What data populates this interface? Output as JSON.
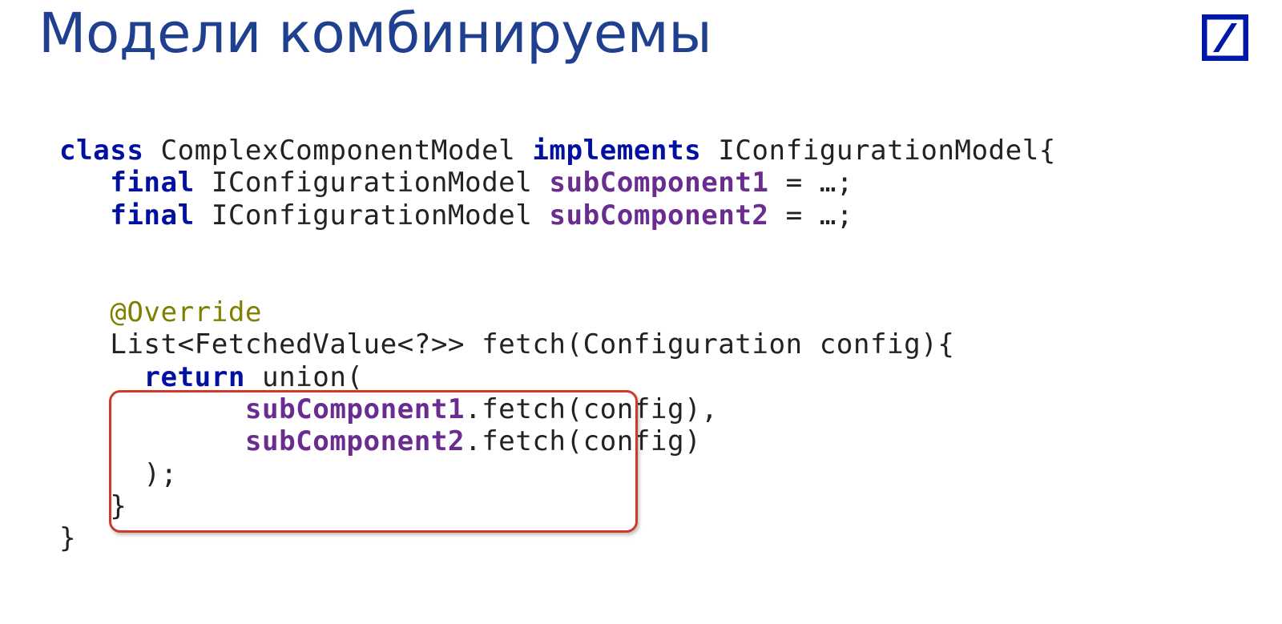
{
  "title": "Модели комбинируемы",
  "code": {
    "kw_class": "class",
    "classname": " ComplexComponentModel ",
    "kw_implements": "implements",
    "iface_tail": " IConfigurationModel{",
    "indent1": "   ",
    "kw_final1": "final",
    "type1": " IConfigurationModel ",
    "fld1": "subComponent1",
    "assign1": " = …;",
    "kw_final2": "final",
    "type2": " IConfigurationModel ",
    "fld2": "subComponent2",
    "assign2": " = …;",
    "ann": "@Override",
    "sig": "List<FetchedValue<?>> fetch(Configuration config){",
    "indent2": "     ",
    "kw_return": "return",
    "union_open": " union(",
    "indent_arg": "           ",
    "arg1_fld": "subComponent1",
    "arg1_tail": ".fetch(config),",
    "arg2_fld": "subComponent2",
    "arg2_tail": ".fetch(config)",
    "close_paren": "     );",
    "close_brace1": "   }",
    "close_brace2": "}"
  }
}
